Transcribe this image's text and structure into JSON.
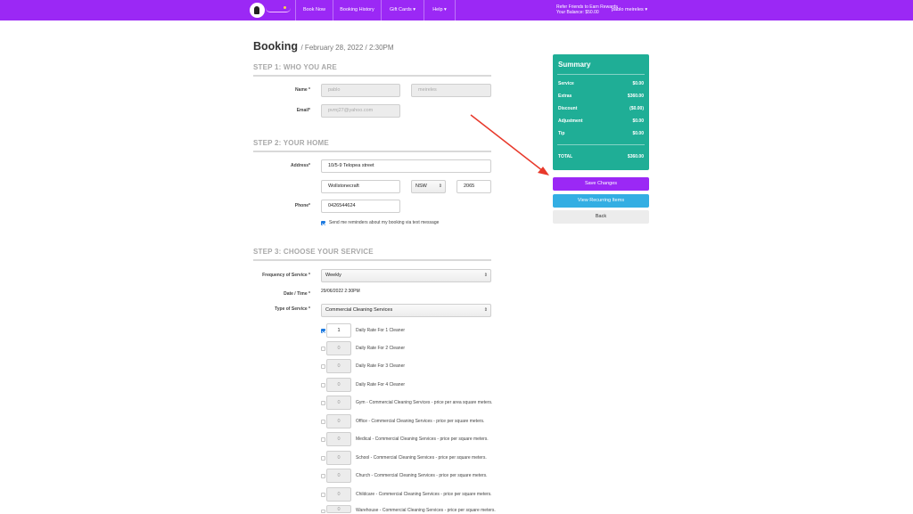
{
  "nav": {
    "items": [
      "Book Now",
      "Booking History",
      "Gift Cards",
      "Help"
    ],
    "rewards_line1": "Refer Friends to Earn Rewards",
    "rewards_line2": "Your Balance: $50.00",
    "user_name": "pablo meireles"
  },
  "page": {
    "title": "Booking",
    "subtitle": "/ February 28, 2022 / 2:30PM"
  },
  "step1": {
    "heading": "STEP 1: WHO YOU ARE",
    "name_label": "Name *",
    "first_name": "pablo",
    "last_name": "meireles",
    "email_label": "Email*",
    "email": "pvmj27@yahoo.com"
  },
  "step2": {
    "heading": "STEP 2: YOUR HOME",
    "address_label": "Address*",
    "address": "10/5-9 Telopea street",
    "suburb": "Wollstonecraft",
    "state": "NSW",
    "postcode": "2065",
    "phone_label": "Phone*",
    "phone": "0426544624",
    "sms_reminder_label": "Send me reminders about my booking via text message"
  },
  "step3": {
    "heading": "STEP 3: CHOOSE YOUR SERVICE",
    "frequency_label": "Frequency of Service *",
    "frequency": "Weekly",
    "datetime_label": "Date / Time *",
    "datetime": "29/06/2022 2:30PM",
    "type_label": "Type of Service *",
    "type": "Commercial Cleaning Services",
    "items": [
      {
        "qty": "1",
        "label": "Daily Rate For 1 Cleaner",
        "checked": true
      },
      {
        "qty": "0",
        "label": "Daily Rate For 2 Cleaner",
        "checked": false
      },
      {
        "qty": "0",
        "label": "Daily Rate For 3 Cleaner",
        "checked": false
      },
      {
        "qty": "0",
        "label": "Daily Rate For 4 Cleaner",
        "checked": false
      },
      {
        "qty": "0",
        "label": "Gym - Commercial Cleaning Services - price per area square meters.",
        "checked": false
      },
      {
        "qty": "0",
        "label": "Office - Commercial Cleaning Services - price per square meters.",
        "checked": false
      },
      {
        "qty": "0",
        "label": "Medical - Commercial Cleaning Services - price per square meters.",
        "checked": false
      },
      {
        "qty": "0",
        "label": "School - Commercial Cleaning Services - price per square meters.",
        "checked": false
      },
      {
        "qty": "0",
        "label": "Church - Commercial Cleaning Services - price per square meters.",
        "checked": false
      },
      {
        "qty": "0",
        "label": "Childcare - Commercial Cleaning Services - price per square meters.",
        "checked": false
      },
      {
        "qty": "0",
        "label": "Warehouse - Commercial Cleaning Services - price per square meters.",
        "checked": false
      }
    ]
  },
  "summary": {
    "title": "Summary",
    "rows": [
      {
        "label": "Service",
        "value": "$0.00"
      },
      {
        "label": "Extras",
        "value": "$360.00"
      },
      {
        "label": "Discount",
        "value": "($0.00)"
      },
      {
        "label": "Adjustment",
        "value": "$0.00"
      },
      {
        "label": "Tip",
        "value": "$0.00"
      }
    ],
    "total_label": "TOTAL",
    "total_value": "$360.00",
    "save_label": "Save Changes",
    "recurring_label": "View Recurring Items",
    "back_label": "Back"
  },
  "colors": {
    "brand_purple": "#9b28f5",
    "summary_green": "#1fae96",
    "recurring_blue": "#33aee3",
    "annotation_red": "#e8392b"
  }
}
